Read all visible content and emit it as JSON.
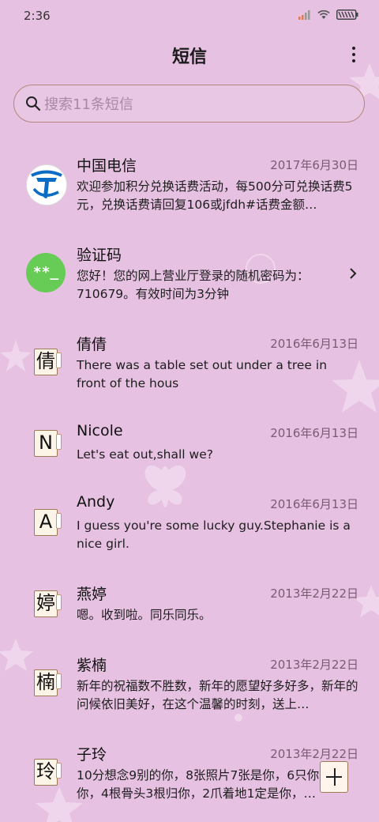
{
  "status_bar": {
    "time": "2:36",
    "icons": [
      "signal-icon",
      "wifi-icon",
      "battery-icon"
    ]
  },
  "header": {
    "title": "短信",
    "menu_icon": "more-vert-icon"
  },
  "search": {
    "placeholder": "搜索11条短信",
    "value": ""
  },
  "messages": [
    {
      "name": "中国电信",
      "date": "2017年6月30日",
      "preview": "欢迎参加积分兑换话费活动，每500分可兑换话费5元，兑换话费请回复106或jfdh#话费金额…",
      "avatar": "telecom-logo"
    },
    {
      "name": "验证码",
      "date": "",
      "preview": "您好！您的网上营业厅登录的随机密码为：710679。有效时间为3分钟",
      "avatar": "**_",
      "chevron": "chevron-right-icon"
    },
    {
      "name": "倩倩",
      "date": "2016年6月13日",
      "preview": "There was a table set out under a tree in front of the hous",
      "avatar": "倩"
    },
    {
      "name": "Nicole",
      "date": "2016年6月13日",
      "preview": "Let's eat out,shall we?",
      "avatar": "N"
    },
    {
      "name": "Andy",
      "date": "2016年6月13日",
      "preview": "I guess you're some lucky guy.Stephanie is a nice girl.",
      "avatar": "A"
    },
    {
      "name": "燕婷",
      "date": "2013年2月22日",
      "preview": "嗯。收到啦。同乐同乐。",
      "avatar": "婷"
    },
    {
      "name": "紫楠",
      "date": "2013年2月22日",
      "preview": "新年的祝福数不胜数，新年的愿望好多好多，新年的问候依旧美好，在这个温馨的时刻，送上…",
      "avatar": "楠"
    },
    {
      "name": "子玲",
      "date": "2013年2月22日",
      "preview": "10分想念9别的你，8张照片7张是你，6只你只像你，4根骨头3根归你，2爪着地1定是你，…",
      "avatar": "玲"
    }
  ],
  "fab": {
    "icon": "plus-icon"
  },
  "colors": {
    "background": "#e6c1e1",
    "search_border": "#b5867a",
    "code_avatar": "#66cc55",
    "telecom_blue": "#0a6cc4"
  }
}
